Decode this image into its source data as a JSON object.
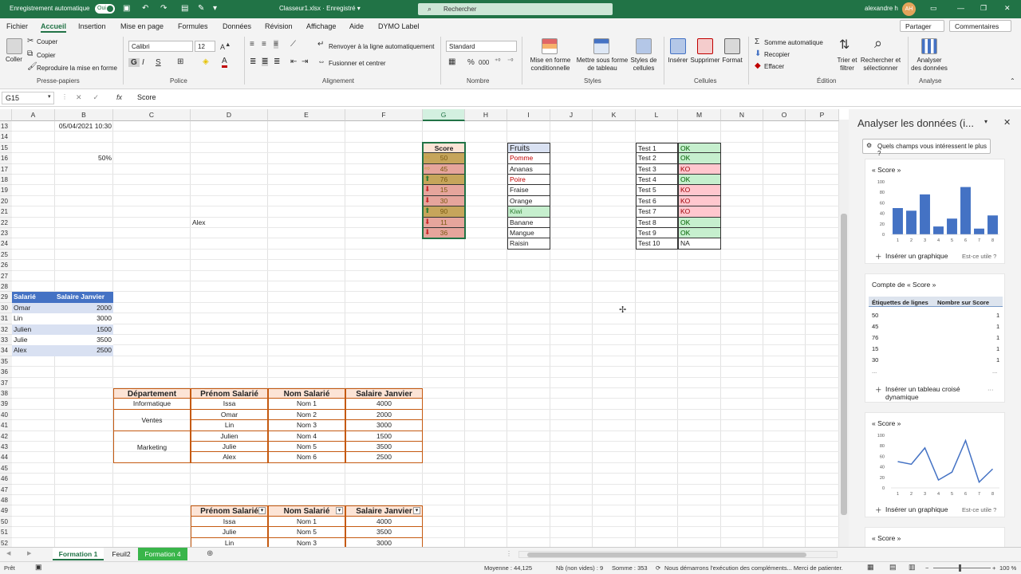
{
  "titlebar": {
    "autosave": "Enregistrement automatique",
    "toggle": "Oui",
    "doc": "Classeur1.xlsx  ·  Enregistré  ▾",
    "search": "Rechercher",
    "user": "alexandre h",
    "initials": "AH"
  },
  "menu": {
    "items": [
      "Fichier",
      "Accueil",
      "Insertion",
      "Mise en page",
      "Formules",
      "Données",
      "Révision",
      "Affichage",
      "Aide",
      "DYMO Label"
    ],
    "share": "Partager",
    "comments": "Commentaires"
  },
  "ribbon": {
    "clipboard": {
      "paste": "Coller",
      "cut": "Couper",
      "copy": "Copier",
      "format": "Reproduire la mise en forme",
      "label": "Presse-papiers"
    },
    "font": {
      "name": "Calibri",
      "size": "12",
      "label": "Police",
      "bold": "G",
      "italic": "I",
      "underline": "S"
    },
    "align": {
      "wrap": "Renvoyer à la ligne automatiquement",
      "merge": "Fusionner et centrer",
      "label": "Alignement"
    },
    "number": {
      "format": "Standard",
      "label": "Nombre",
      "percent": "%",
      "thousands": "000"
    },
    "styles": {
      "cond": "Mise en forme\nconditionnelle",
      "table": "Mettre sous forme\nde tableau",
      "cell": "Styles de\ncellules",
      "label": "Styles"
    },
    "cells": {
      "insert": "Insérer",
      "delete": "Supprimer",
      "format": "Format",
      "label": "Cellules"
    },
    "editing": {
      "autosum": "Somme automatique",
      "fill": "Recopier",
      "clear": "Effacer",
      "sort": "Trier et\nfiltrer",
      "find": "Rechercher et\nsélectionner",
      "label": "Édition"
    },
    "analysis": {
      "analyze": "Analyser\ndes données",
      "label": "Analyse"
    }
  },
  "formula_bar": {
    "namebox": "G15",
    "content": "Score"
  },
  "columns": [
    "A",
    "B",
    "C",
    "D",
    "E",
    "F",
    "G",
    "H",
    "I",
    "J",
    "K",
    "L",
    "M",
    "N",
    "O",
    "P"
  ],
  "rows": [
    "13",
    "14",
    "15",
    "16",
    "17",
    "18",
    "19",
    "20",
    "21",
    "22",
    "23",
    "24",
    "25",
    "26",
    "27",
    "28",
    "29",
    "30",
    "31",
    "32",
    "33",
    "34",
    "35",
    "36",
    "37",
    "38",
    "39",
    "40",
    "41",
    "42",
    "43",
    "44",
    "45",
    "46",
    "47",
    "48",
    "49",
    "50",
    "51",
    "52"
  ],
  "sheet": {
    "b13": "05/04/2021 10:30",
    "b16": "50%",
    "d22": "Alex",
    "score": {
      "header": "Score",
      "values": [
        "50",
        "45",
        "76",
        "15",
        "30",
        "90",
        "11",
        "36"
      ]
    },
    "fruits": {
      "header": "Fruits",
      "items": [
        "Pomme",
        "Ananas",
        "Poire",
        "Fraise",
        "Orange",
        "Kiwi",
        "Banane",
        "Mangue",
        "Raisin"
      ]
    },
    "tests": [
      [
        "Test 1",
        "OK"
      ],
      [
        "Test 2",
        "OK"
      ],
      [
        "Test 3",
        "KO"
      ],
      [
        "Test 4",
        "OK"
      ],
      [
        "Test 5",
        "KO"
      ],
      [
        "Test 6",
        "KO"
      ],
      [
        "Test 7",
        "KO"
      ],
      [
        "Test 8",
        "OK"
      ],
      [
        "Test 9",
        "OK"
      ],
      [
        "Test 10",
        "NA"
      ]
    ],
    "salary_table": {
      "headers": [
        "Salarié",
        "Salaire Janvier"
      ],
      "rows": [
        [
          "Omar",
          "2000"
        ],
        [
          "Lin",
          "3000"
        ],
        [
          "Julien",
          "1500"
        ],
        [
          "Julie",
          "3500"
        ],
        [
          "Alex",
          "2500"
        ]
      ]
    },
    "dept_table": {
      "headers": [
        "Département",
        "Prénom Salarié",
        "Nom Salarié",
        "Salaire Janvier"
      ],
      "depts": [
        "Informatique",
        "Ventes",
        "Marketing"
      ],
      "rows": [
        [
          "Issa",
          "Nom 1",
          "4000"
        ],
        [
          "Omar",
          "Nom 2",
          "2000"
        ],
        [
          "Lin",
          "Nom 3",
          "3000"
        ],
        [
          "Julien",
          "Nom 4",
          "1500"
        ],
        [
          "Julie",
          "Nom 5",
          "3500"
        ],
        [
          "Alex",
          "Nom 6",
          "2500"
        ]
      ]
    },
    "filter_table": {
      "headers": [
        "Prénom Salarié",
        "Nom Salarié",
        "Salaire Janvier"
      ],
      "rows": [
        [
          "Issa",
          "Nom 1",
          "4000"
        ],
        [
          "Julie",
          "Nom 5",
          "3500"
        ],
        [
          "Lin",
          "Nom 3",
          "3000"
        ]
      ]
    }
  },
  "taskpane": {
    "title": "Analyser les données (i...",
    "question": "Quels champs vous intéressent le plus ?",
    "card1_title": "« Score »",
    "card2_title": "Compte de « Score »",
    "pivot_h1": "Étiquettes de lignes",
    "pivot_h2": "Nombre sur Score",
    "pivot_rows": [
      [
        "50",
        "1"
      ],
      [
        "45",
        "1"
      ],
      [
        "76",
        "1"
      ],
      [
        "15",
        "1"
      ],
      [
        "30",
        "1"
      ]
    ],
    "ellipsis": "...",
    "insert_chart": "Insérer un graphique",
    "useful": "Est-ce utile ?",
    "insert_pivot": "Insérer un tableau croisé dynamique",
    "card3_title": "« Score »",
    "card4_title": "« Score »"
  },
  "chart_data": [
    {
      "type": "bar",
      "categories": [
        "1",
        "2",
        "3",
        "4",
        "5",
        "6",
        "7",
        "8"
      ],
      "values": [
        50,
        45,
        76,
        15,
        30,
        90,
        11,
        36
      ],
      "ylim": [
        0,
        100
      ],
      "yticks": [
        "100",
        "80",
        "60",
        "40",
        "20",
        "0"
      ],
      "color": "#4472c4"
    },
    {
      "type": "line",
      "categories": [
        "1",
        "2",
        "3",
        "4",
        "5",
        "6",
        "7",
        "8"
      ],
      "values": [
        50,
        45,
        76,
        15,
        30,
        90,
        11,
        36
      ],
      "ylim": [
        0,
        100
      ],
      "yticks": [
        "100",
        "80",
        "60",
        "40",
        "20",
        "0"
      ],
      "color": "#4472c4"
    }
  ],
  "tabs": {
    "items": [
      "Formation 1",
      "Feuil2",
      "Formation 4"
    ]
  },
  "status": {
    "ready": "Prêt",
    "avg": "Moyenne : 44,125",
    "count": "Nb (non vides) : 9",
    "sum": "Somme : 353",
    "msg": "Nous démarrons l'exécution des compléments... Merci de patienter.",
    "zoom": "100 %"
  }
}
